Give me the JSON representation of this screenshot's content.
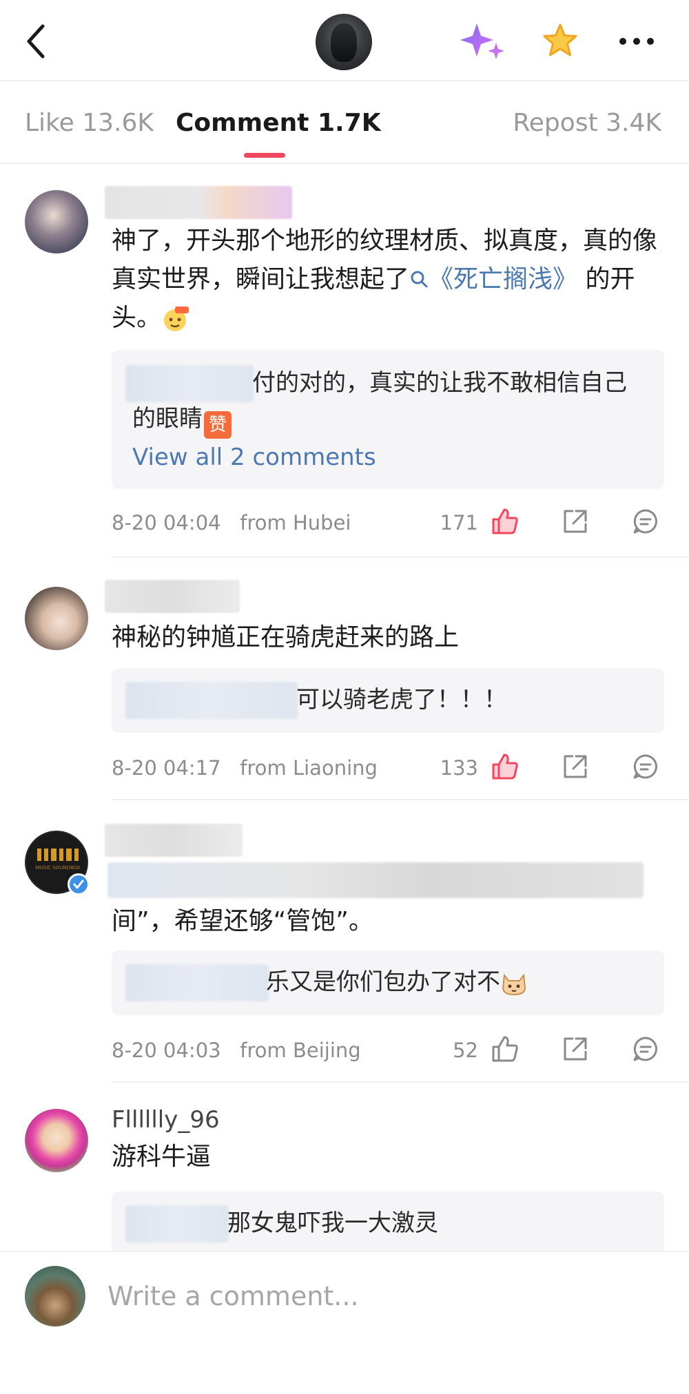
{
  "header": {
    "back_icon": "chevron-left-icon",
    "ai_icon": "sparkle-icon",
    "favorite_icon": "star-icon",
    "more_icon": "more-dots-icon",
    "colors": {
      "accent": "#f0475f",
      "star": "#f7b52c",
      "sparkle": "#a86cf0",
      "link": "#4c78b0"
    }
  },
  "tabs": [
    {
      "label": "Like 13.6K",
      "active": false
    },
    {
      "label": "Comment 1.7K",
      "active": true
    },
    {
      "label": "Repost 3.4K",
      "active": false
    }
  ],
  "comments": [
    {
      "text_parts": [
        "神了，开头那个地形的纹理材质、拟真度，真的像真实世界，瞬间让我想起了",
        "《死亡搁浅》",
        "的开头。"
      ],
      "emoji": "666-emoji",
      "reply": {
        "text_line1": "付的对的，真实的让我不敢相信自己",
        "text_line2": "的眼睛",
        "emoji": "赞",
        "view_all": "View all 2 comments"
      },
      "time": "8-20 04:04",
      "location": "from Hubei",
      "likes": "171",
      "liked": true
    },
    {
      "text": "神秘的钟馗正在骑虎赶来的路上",
      "reply": {
        "text": "可以骑老虎了！！！"
      },
      "time": "8-20 04:17",
      "location": "from Liaoning",
      "likes": "133",
      "liked": true
    },
    {
      "text": "间”，希望还够“管饱”。",
      "avatar_text": "MUSIC SOUNDBOX",
      "reply": {
        "text": "乐又是你们包办了对不"
      },
      "time": "8-20 04:03",
      "location": "from Beijing",
      "likes": "52",
      "liked": false
    },
    {
      "username": "Flllllly_96",
      "text": "游科牛逼",
      "reply": {
        "text": "那女鬼吓我一大激灵"
      }
    }
  ],
  "composer": {
    "placeholder": "Write a comment..."
  }
}
